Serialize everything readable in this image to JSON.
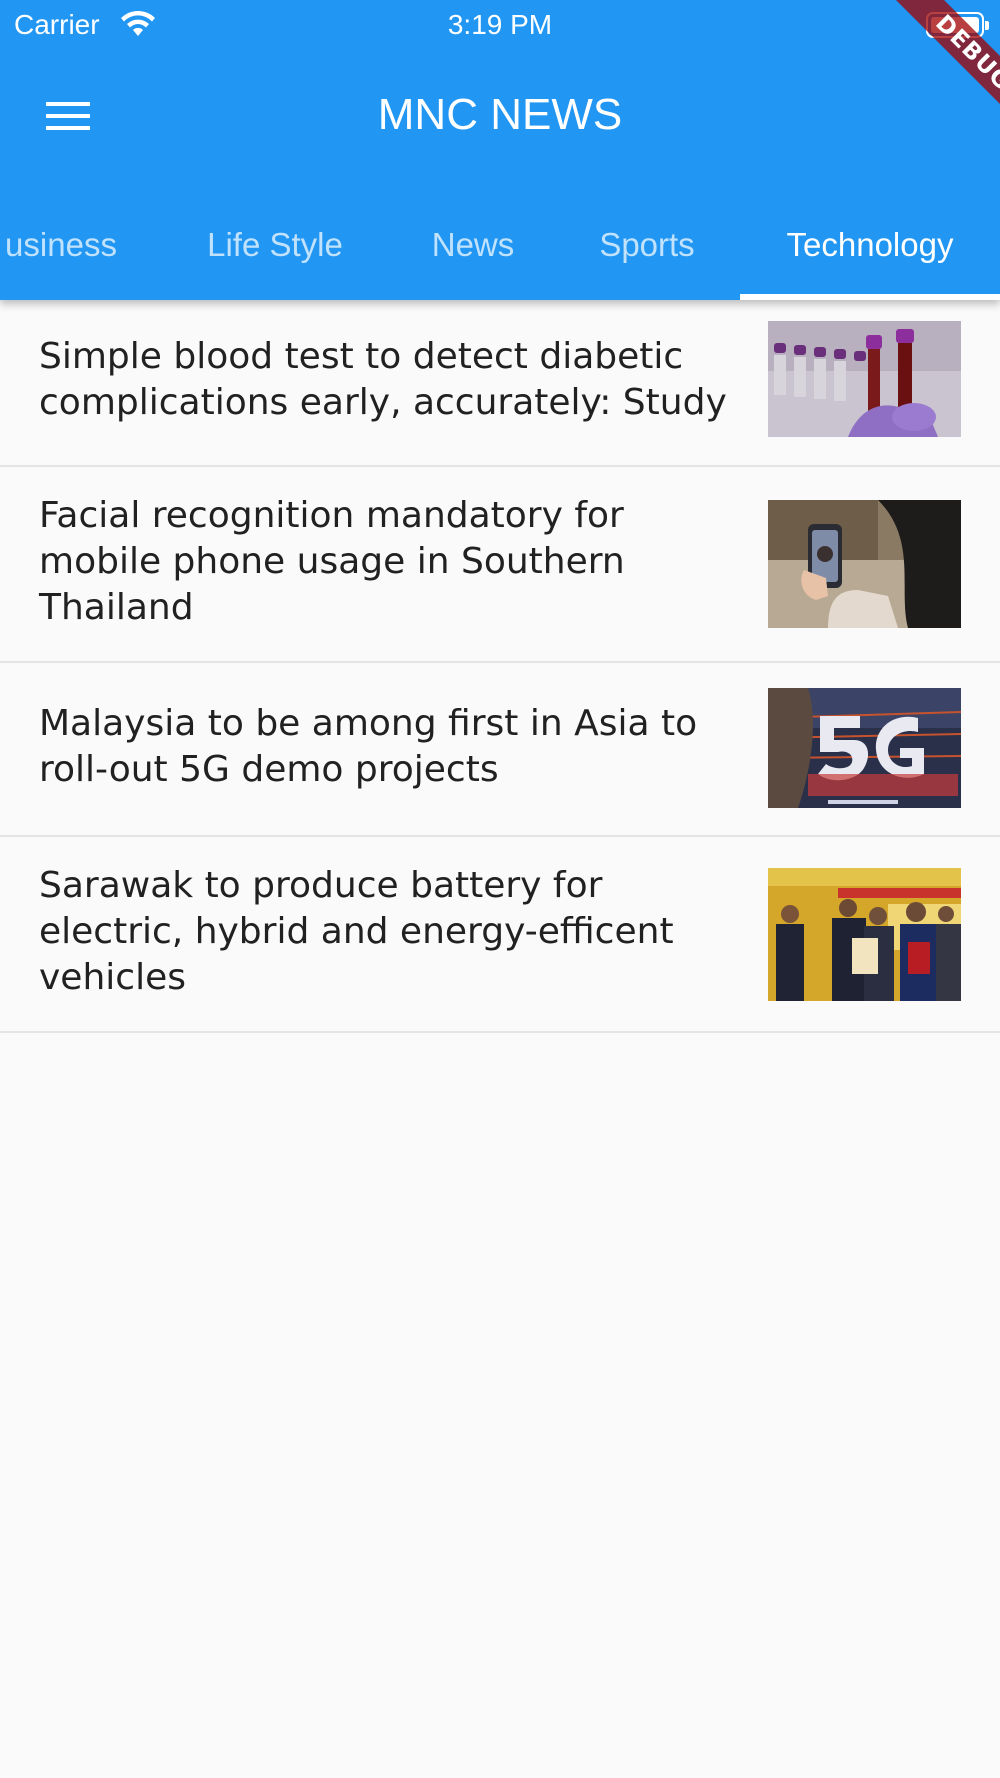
{
  "status_bar": {
    "carrier": "Carrier",
    "time": "3:19 PM"
  },
  "app_bar": {
    "title": "MNC NEWS",
    "menu_icon": "hamburger-menu-icon"
  },
  "tabs": [
    {
      "label": "Business",
      "visible_text": "usiness",
      "active": false
    },
    {
      "label": "Life Style",
      "active": false
    },
    {
      "label": "News",
      "active": false
    },
    {
      "label": "Sports",
      "active": false
    },
    {
      "label": "Technology",
      "active": true
    }
  ],
  "debug_banner": "DEBUG",
  "articles": [
    {
      "title": "Simple blood test to detect diabetic complications early, accurately: Study"
    },
    {
      "title": "Facial recognition mandatory for mobile phone usage in Southern Thailand"
    },
    {
      "title": "Malaysia to be among first in Asia to roll-out 5G demo projects"
    },
    {
      "title": "Sarawak to produce battery for electric, hybrid and energy-efficent vehicles"
    }
  ],
  "colors": {
    "primary": "#2196f3",
    "background": "#fafafa",
    "text": "#212121",
    "divider": "#e4e4e4",
    "debug_ribbon": "#a00000"
  }
}
